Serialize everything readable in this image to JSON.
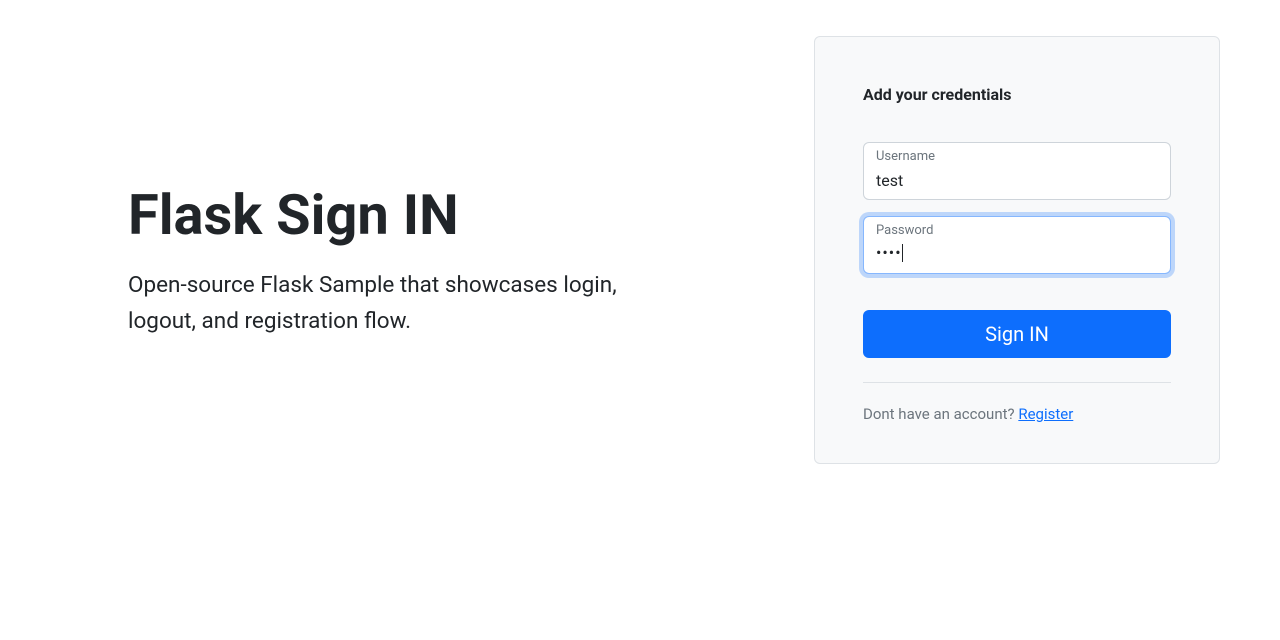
{
  "left": {
    "title": "Flask Sign IN",
    "subtitle": "Open-source Flask Sample that showcases login, logout, and registration flow."
  },
  "card": {
    "heading": "Add your credentials",
    "username": {
      "label": "Username",
      "value": "test"
    },
    "password": {
      "label": "Password",
      "masked_value": "••••"
    },
    "submit_label": "Sign IN",
    "footer_text": "Dont have an account? ",
    "footer_link": "Register"
  }
}
